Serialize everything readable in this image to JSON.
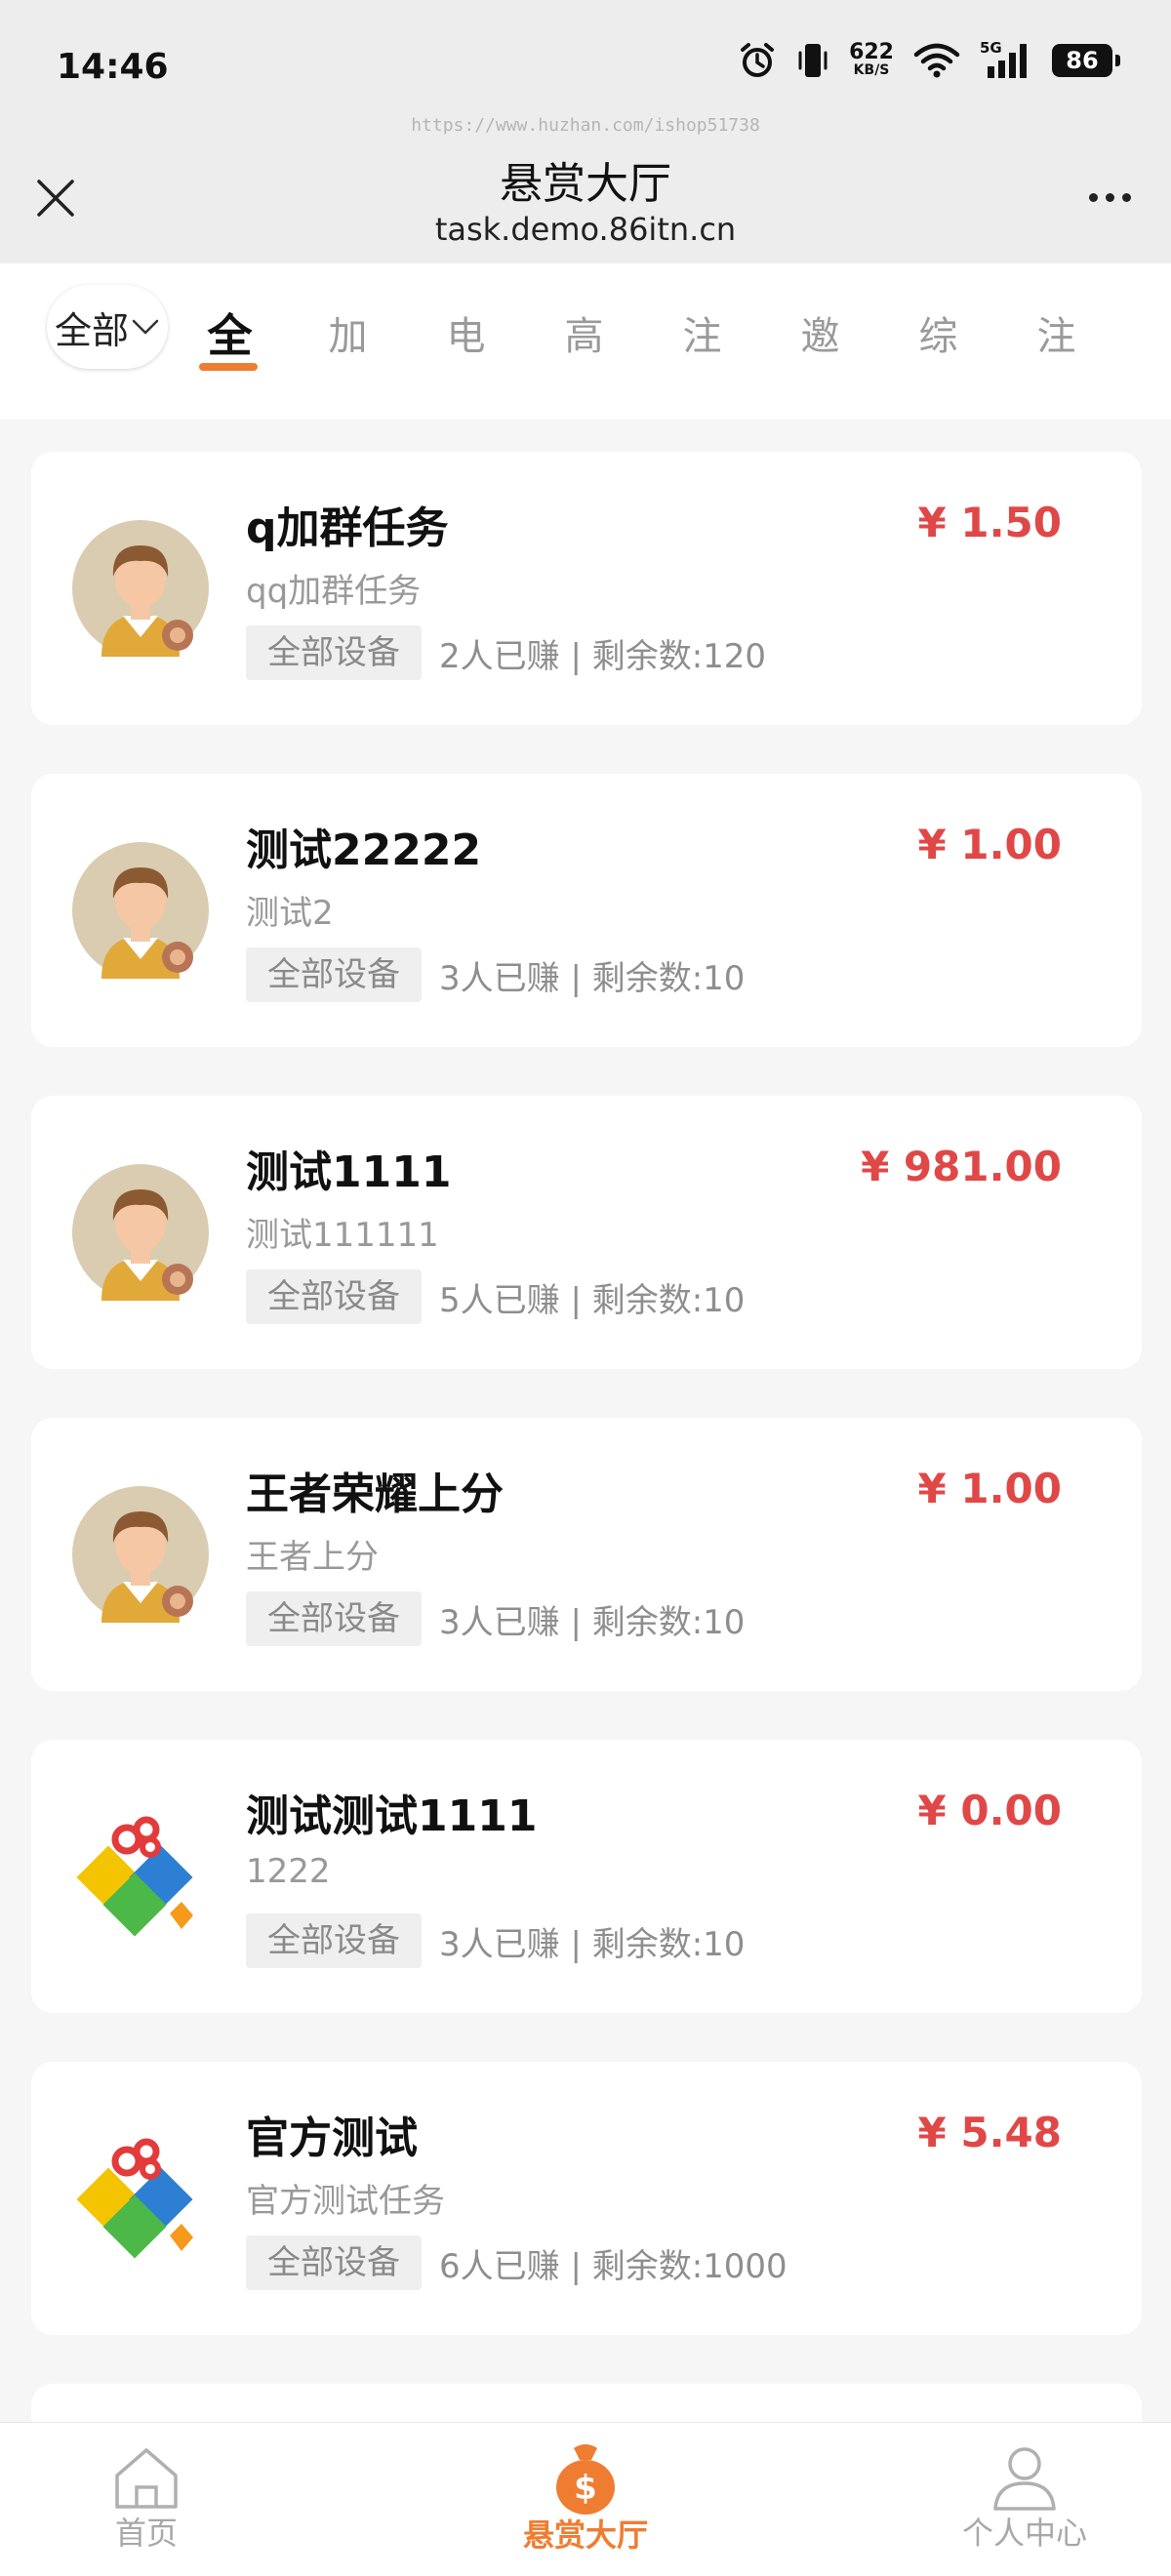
{
  "status_bar": {
    "time": "14:46",
    "net_speed": "622",
    "net_unit": "KB/S",
    "signal": "5G",
    "battery": "86"
  },
  "nav": {
    "watermark": "https://www.huzhan.com/ishop51738",
    "title": "悬赏大厅",
    "subtitle": "task.demo.86itn.cn"
  },
  "filter": {
    "select_label": "全部",
    "tabs": [
      "全",
      "加",
      "电",
      "高",
      "注",
      "邀",
      "综",
      "注"
    ]
  },
  "tasks": [
    {
      "title": "q加群任务",
      "subtitle": "qq加群任务",
      "tag": "全部设备",
      "stats": "2人已赚 | 剩余数:120",
      "price": "¥ 1.50",
      "avatar": "person-avatar"
    },
    {
      "title": "测试22222",
      "subtitle": "测试2",
      "tag": "全部设备",
      "stats": "3人已赚 | 剩余数:10",
      "price": "¥ 1.00",
      "avatar": "person-avatar"
    },
    {
      "title": "测试1111",
      "subtitle": "测试111111",
      "tag": "全部设备",
      "stats": "5人已赚 | 剩余数:10",
      "price": "¥ 981.00",
      "avatar": "person-avatar"
    },
    {
      "title": "王者荣耀上分",
      "subtitle": "王者上分",
      "tag": "全部设备",
      "stats": "3人已赚 | 剩余数:10",
      "price": "¥ 1.00",
      "avatar": "person-avatar"
    },
    {
      "title": "测试测试1111",
      "subtitle": "1222",
      "tag": "全部设备",
      "stats": "3人已赚 | 剩余数:10",
      "price": "¥ 0.00",
      "avatar": "colorful-logo"
    },
    {
      "title": "官方测试",
      "subtitle": "官方测试任务",
      "tag": "全部设备",
      "stats": "6人已赚 | 剩余数:1000",
      "price": "¥ 5.48",
      "avatar": "colorful-logo"
    }
  ],
  "tabbar": {
    "home": "首页",
    "hall": "悬赏大厅",
    "me": "个人中心"
  },
  "colors": {
    "accent": "#ee7d32",
    "price": "#e04848"
  }
}
